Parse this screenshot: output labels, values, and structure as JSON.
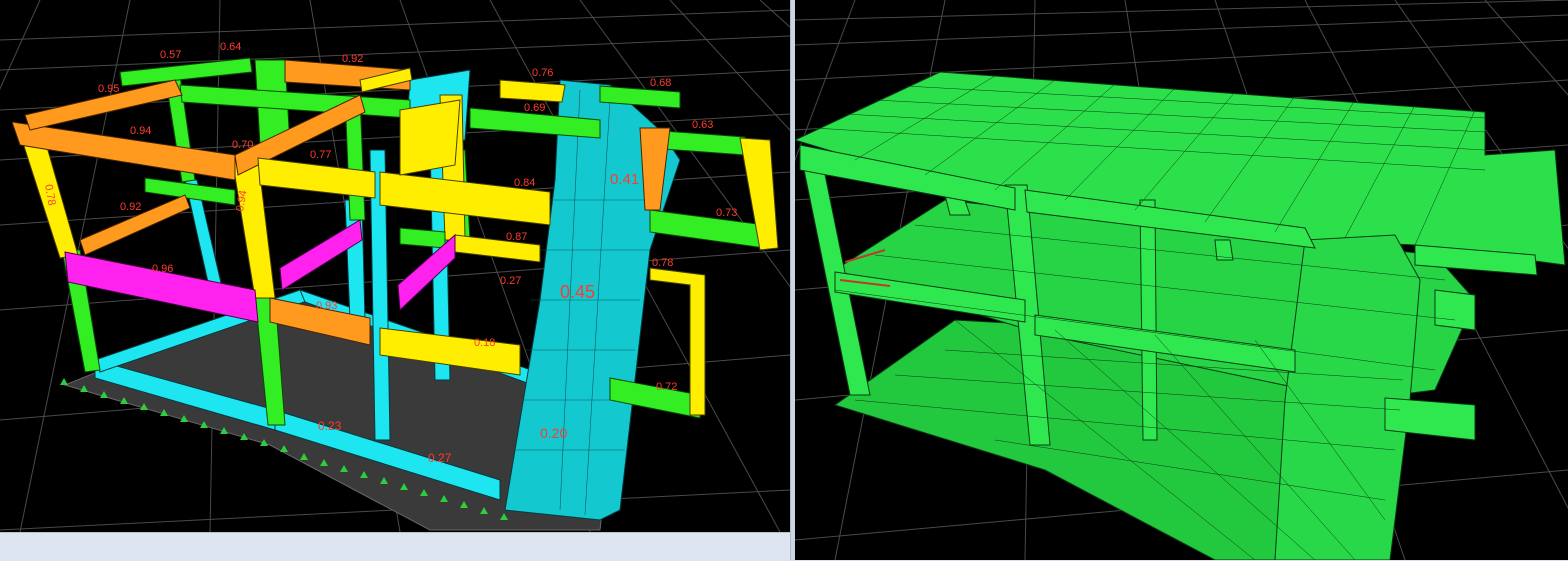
{
  "window": {
    "title": ""
  },
  "viewports": {
    "left": {
      "mode": "stress-ratio",
      "colors": {
        "orange": "#ff9a1e",
        "yellow": "#ffee00",
        "green": "#33ee22",
        "cyan": "#1ee6f0",
        "magenta": "#ff22ee",
        "label": "#ff3b2f",
        "grid": "#555555",
        "background": "#000000"
      },
      "labels": {
        "l_057": "0.57",
        "l_064": "0.64",
        "l_092a": "0.92",
        "l_095": "0.95",
        "l_094a": "0.94",
        "l_076a": "0.76",
        "l_069": "0.69",
        "l_068": "0.68",
        "l_063": "0.63",
        "l_077": "0.77",
        "l_078a": "0.78",
        "l_094b": "0.94",
        "l_092b": "0.92",
        "l_084": "0.84",
        "l_041": "0.41",
        "l_073": "0.73",
        "l_087": "0.87",
        "l_078b": "0.78",
        "l_096": "0.96",
        "l_027a": "0.27",
        "l_045": "0.45",
        "l_018": "0.18",
        "l_072": "0.72",
        "l_023": "0.23",
        "l_027b": "0.27",
        "l_020": "0.20",
        "l_093": "0.93",
        "l_070": "0.70"
      }
    },
    "right": {
      "mode": "deformed-shape",
      "colors": {
        "mesh": "#29e04a",
        "edge": "#0a3b12",
        "grid": "#555555",
        "background": "#000000"
      }
    }
  }
}
